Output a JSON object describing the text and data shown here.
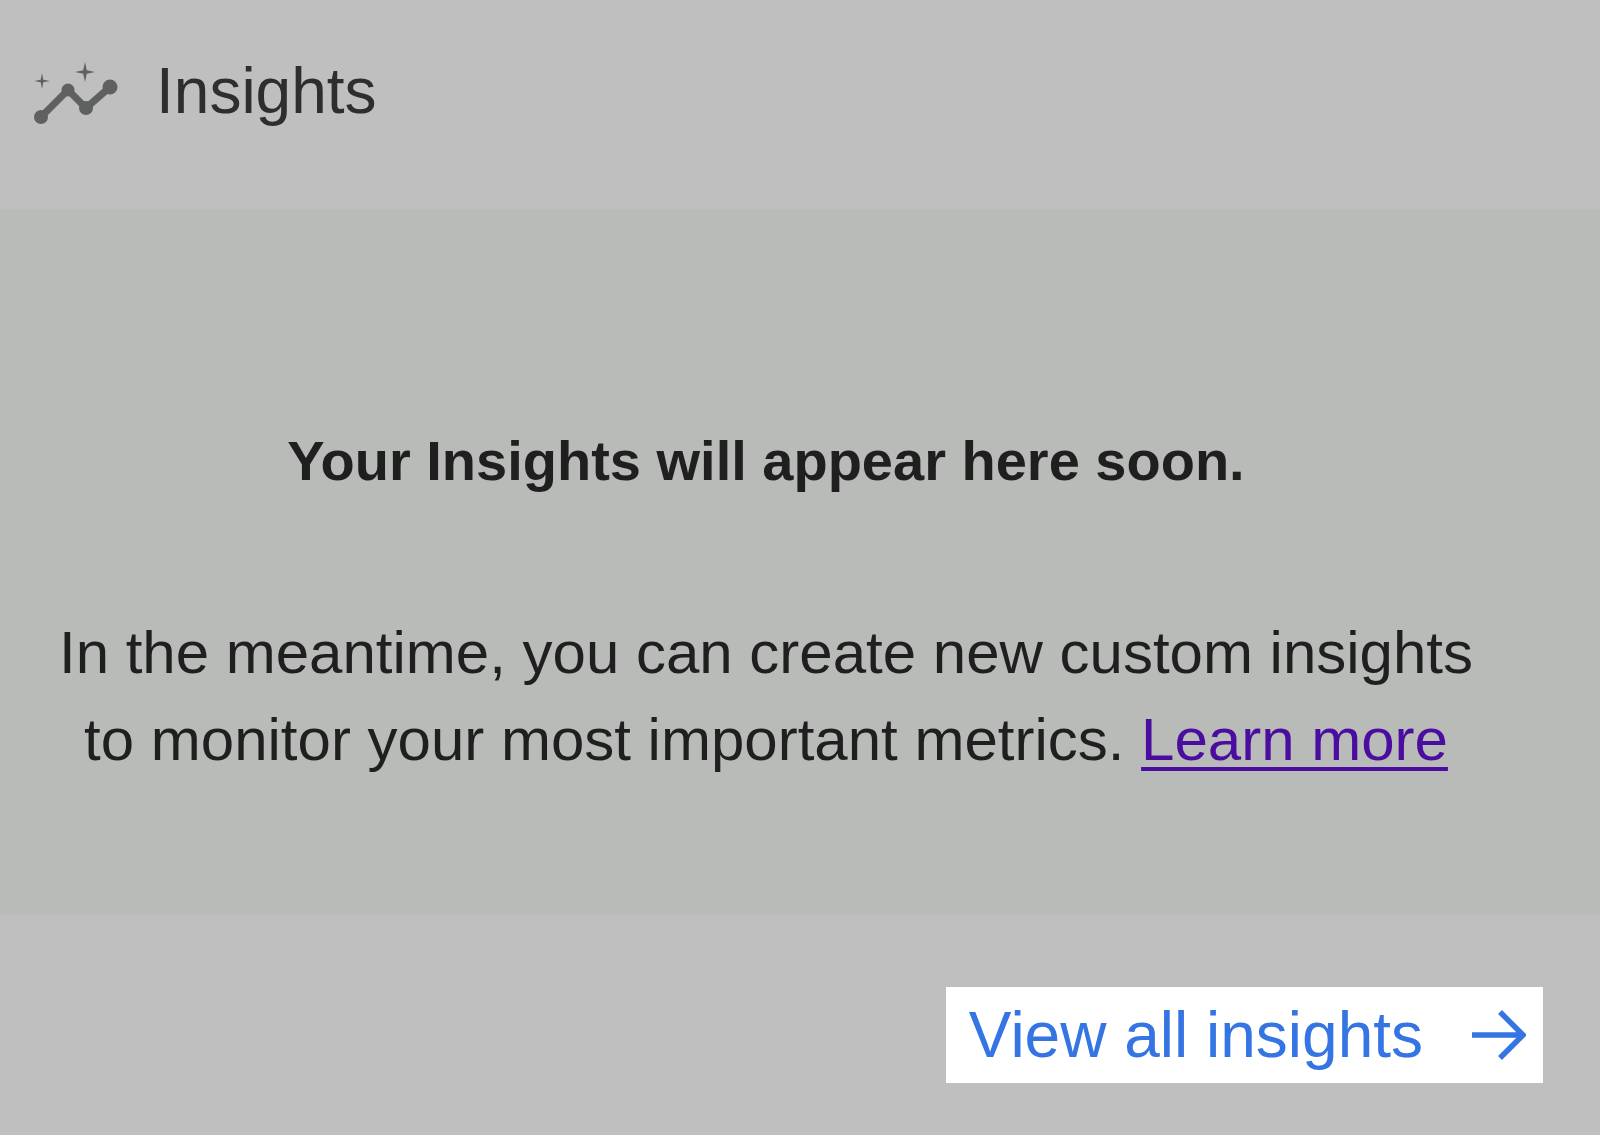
{
  "header": {
    "title": "Insights"
  },
  "empty_state": {
    "heading": "Your Insights will appear here soon.",
    "message": "In the meantime, you can create new custom insights to monitor your most important metrics.",
    "link": {
      "label": "Learn more",
      "visited": true
    }
  },
  "footer": {
    "button": "View all insights"
  }
}
